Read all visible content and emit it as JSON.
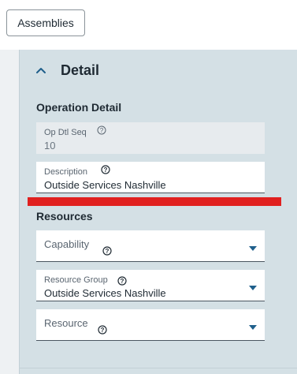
{
  "toolbar": {
    "assemblies_label": "Assemblies"
  },
  "panel": {
    "title": "Detail"
  },
  "operation_detail": {
    "section_title": "Operation Detail",
    "op_dtl_seq": {
      "label": "Op Dtl Seq",
      "value": "10"
    },
    "description": {
      "label": "Description",
      "value": "Outside Services Nashville"
    }
  },
  "resources": {
    "section_title": "Resources",
    "capability": {
      "label": "Capability",
      "value": ""
    },
    "resource_group": {
      "label": "Resource Group",
      "value": "Outside Services Nashville"
    },
    "resource": {
      "label": "Resource",
      "value": ""
    }
  },
  "colors": {
    "panel_bg": "#d4e0e5",
    "accent": "#1f5f8b",
    "annotation_red": "#e0201f"
  },
  "icons": [
    "chevron-up-icon",
    "help-icon",
    "caret-down-icon"
  ]
}
